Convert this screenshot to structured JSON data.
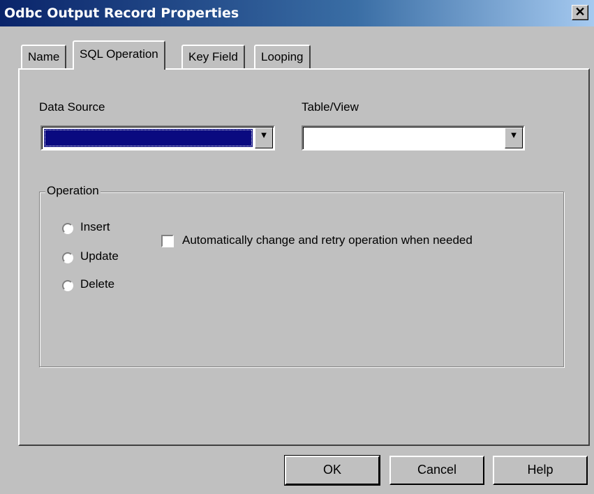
{
  "window": {
    "title": "Odbc Output Record Properties",
    "close_glyph": "✕"
  },
  "tabs": [
    {
      "label": "Name"
    },
    {
      "label": "SQL Operation",
      "active": true
    },
    {
      "label": "Key Field"
    },
    {
      "label": "Looping"
    }
  ],
  "data_source": {
    "label": "Data Source",
    "value": ""
  },
  "table_view": {
    "label": "Table/View",
    "value": ""
  },
  "operation": {
    "label": "Operation",
    "options": [
      {
        "label": "Insert"
      },
      {
        "label": "Update"
      },
      {
        "label": "Delete"
      }
    ],
    "auto_retry_label": "Automatically change and retry operation when needed"
  },
  "buttons": {
    "ok": "OK",
    "cancel": "Cancel",
    "help": "Help"
  },
  "colors": {
    "selection": "#0a0a80",
    "face": "#c0c0c0",
    "title_start": "#0a246a"
  },
  "icons": {
    "dropdown": "▼"
  }
}
